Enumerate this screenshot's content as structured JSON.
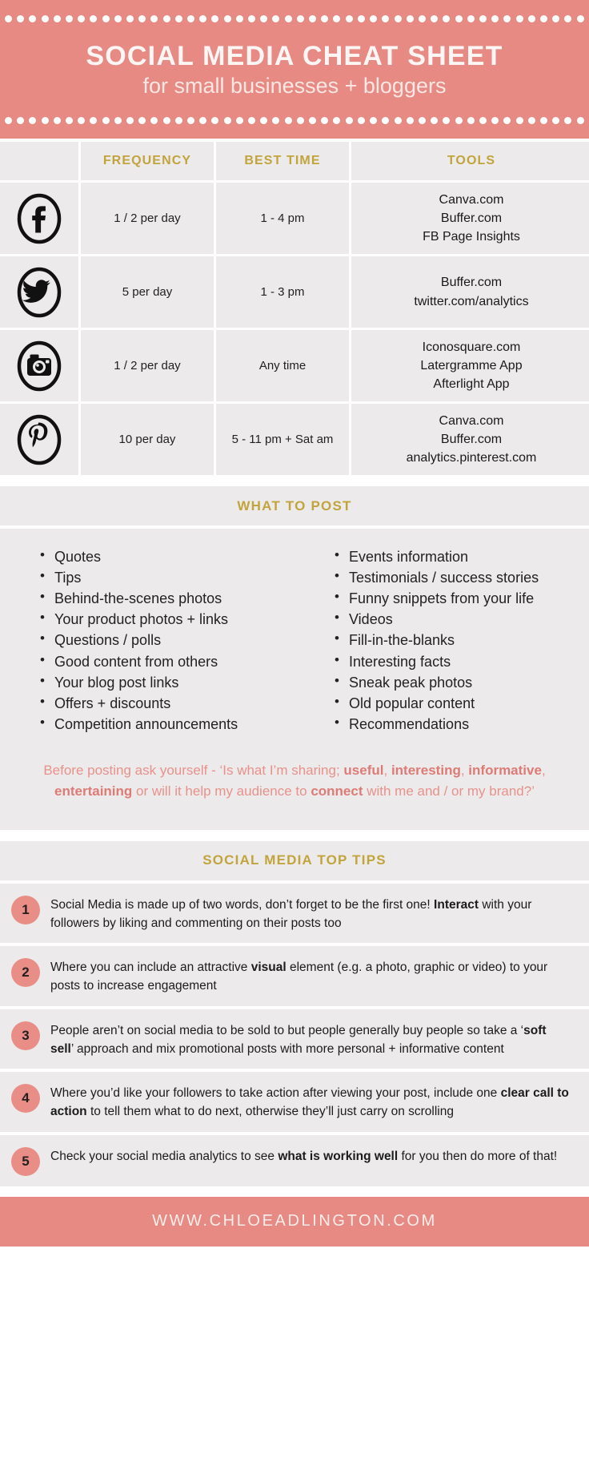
{
  "header": {
    "title": "SOCIAL MEDIA  CHEAT SHEET",
    "subtitle": "for small businesses + bloggers",
    "bg_color": "#e78a84"
  },
  "table": {
    "columns": [
      "",
      "FREQUENCY",
      "BEST TIME",
      "TOOLS"
    ],
    "rows": [
      {
        "platform": "facebook",
        "icon": "facebook-icon",
        "frequency": "1 / 2 per day",
        "best_time": "1 - 4 pm",
        "tools": [
          "Canva.com",
          "Buffer.com",
          "FB Page Insights"
        ]
      },
      {
        "platform": "twitter",
        "icon": "twitter-icon",
        "frequency": "5 per day",
        "best_time": "1 - 3 pm",
        "tools": [
          "Buffer.com",
          "twitter.com/analytics"
        ]
      },
      {
        "platform": "instagram",
        "icon": "instagram-icon",
        "frequency": "1 / 2 per day",
        "best_time": "Any time",
        "tools": [
          "Iconosquare.com",
          "Latergramme App",
          "Afterlight App"
        ]
      },
      {
        "platform": "pinterest",
        "icon": "pinterest-icon",
        "frequency": "10 per day",
        "best_time": "5 - 11 pm + Sat am",
        "tools": [
          "Canva.com",
          "Buffer.com",
          "analytics.pinterest.com"
        ]
      }
    ]
  },
  "what_to_post": {
    "heading": "WHAT TO POST",
    "left": [
      "Quotes",
      "Tips",
      "Behind-the-scenes photos",
      "Your product photos + links",
      "Questions / polls",
      "Good content from others",
      "Your blog post links",
      "Offers + discounts",
      "Competition announcements"
    ],
    "right": [
      "Events information",
      "Testimonials / success stories",
      "Funny snippets from your life",
      "Videos",
      "Fill-in-the-blanks",
      "Interesting facts",
      "Sneak peak photos",
      "Old popular content",
      "Recommendations"
    ],
    "ask_parts": [
      {
        "text": "Before posting ask yourself - ‘Is what I’m sharing; ",
        "bold": false
      },
      {
        "text": "useful",
        "bold": true
      },
      {
        "text": ", ",
        "bold": false
      },
      {
        "text": "interesting",
        "bold": true
      },
      {
        "text": ", ",
        "bold": false
      },
      {
        "text": "informative",
        "bold": true
      },
      {
        "text": ", ",
        "bold": false
      },
      {
        "text": "entertaining",
        "bold": true
      },
      {
        "text": " or will it help my audience to ",
        "bold": false
      },
      {
        "text": "connect",
        "bold": true
      },
      {
        "text": " with me and / or my brand?’",
        "bold": false
      }
    ]
  },
  "top_tips": {
    "heading": "SOCIAL MEDIA TOP TIPS",
    "badge_color": "#e98d87",
    "items": [
      {
        "number": "1",
        "parts": [
          {
            "text": "Social Media is made up of two words, don’t forget to be the first one! ",
            "bold": false
          },
          {
            "text": "Interact",
            "bold": true
          },
          {
            "text": " with your followers by liking and commenting on their posts too",
            "bold": false
          }
        ]
      },
      {
        "number": "2",
        "parts": [
          {
            "text": "Where you can include an attractive ",
            "bold": false
          },
          {
            "text": "visual",
            "bold": true
          },
          {
            "text": " element (e.g. a photo, graphic or video) to your posts to increase engagement",
            "bold": false
          }
        ]
      },
      {
        "number": "3",
        "parts": [
          {
            "text": "People aren’t on social media to be sold to but people generally buy people so take a ‘",
            "bold": false
          },
          {
            "text": "soft sell",
            "bold": true
          },
          {
            "text": "’ approach and mix promotional posts with more personal + informative content",
            "bold": false
          }
        ]
      },
      {
        "number": "4",
        "parts": [
          {
            "text": "Where you’d like your followers to take action after viewing your post, include one ",
            "bold": false
          },
          {
            "text": "clear call to action",
            "bold": true
          },
          {
            "text": " to tell them what to do next, otherwise they’ll just carry on scrolling",
            "bold": false
          }
        ]
      },
      {
        "number": "5",
        "parts": [
          {
            "text": "Check your social media analytics to see ",
            "bold": false
          },
          {
            "text": "what is working well",
            "bold": true
          },
          {
            "text": " for you then do more of that!",
            "bold": false
          }
        ]
      }
    ]
  },
  "footer": {
    "url": "WWW.CHLOEADLINGTON.COM"
  },
  "colors": {
    "coral": "#e78a84",
    "gold": "#c2a43c",
    "panel": "#eceaea",
    "pink_text": "#e8918b"
  }
}
